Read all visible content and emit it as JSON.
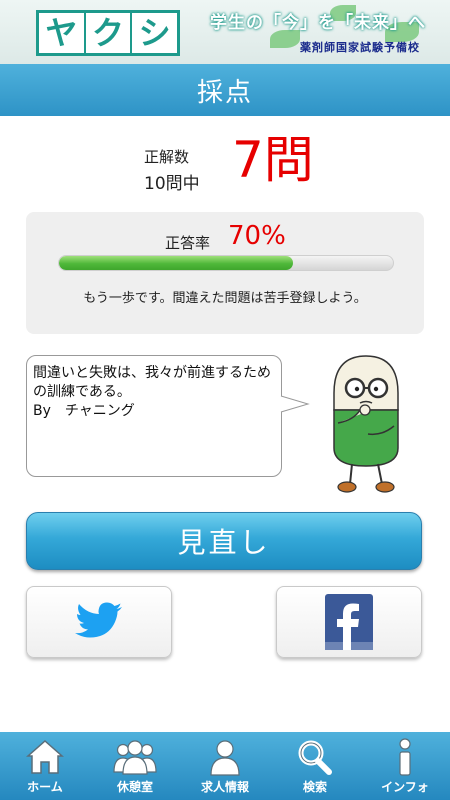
{
  "banner": {
    "logo_chars": [
      "ヤ",
      "ク",
      "シ"
    ],
    "slogan": "学生の「今」を「未来」へ",
    "school": "薬剤師国家試験予備校"
  },
  "header": {
    "title": "採点"
  },
  "score": {
    "label": "正解数",
    "total": "10問中",
    "value": "7問"
  },
  "rate": {
    "label": "正答率",
    "value": "70%",
    "progress_fraction": 0.7,
    "message": "もう一歩です。間違えた問題は苦手登録しよう。"
  },
  "quote": {
    "text": "間違いと失敗は、我々が前進するための訓練である。\nBy　チャニング"
  },
  "buttons": {
    "review_label": "見直し",
    "twitter_icon": "twitter-bird-icon",
    "facebook_icon": "facebook-f-icon"
  },
  "nav": {
    "items": [
      {
        "label": "ホーム",
        "icon": "home-icon"
      },
      {
        "label": "休憩室",
        "icon": "people-icon"
      },
      {
        "label": "求人情報",
        "icon": "person-icon"
      },
      {
        "label": "検索",
        "icon": "search-icon"
      },
      {
        "label": "インフォ",
        "icon": "info-icon"
      }
    ]
  },
  "colors": {
    "accent_blue": "#2e93c6",
    "score_red": "#e60000",
    "progress_green": "#4fb83a",
    "twitter_blue": "#1da1f2",
    "facebook_blue": "#3b5998"
  }
}
